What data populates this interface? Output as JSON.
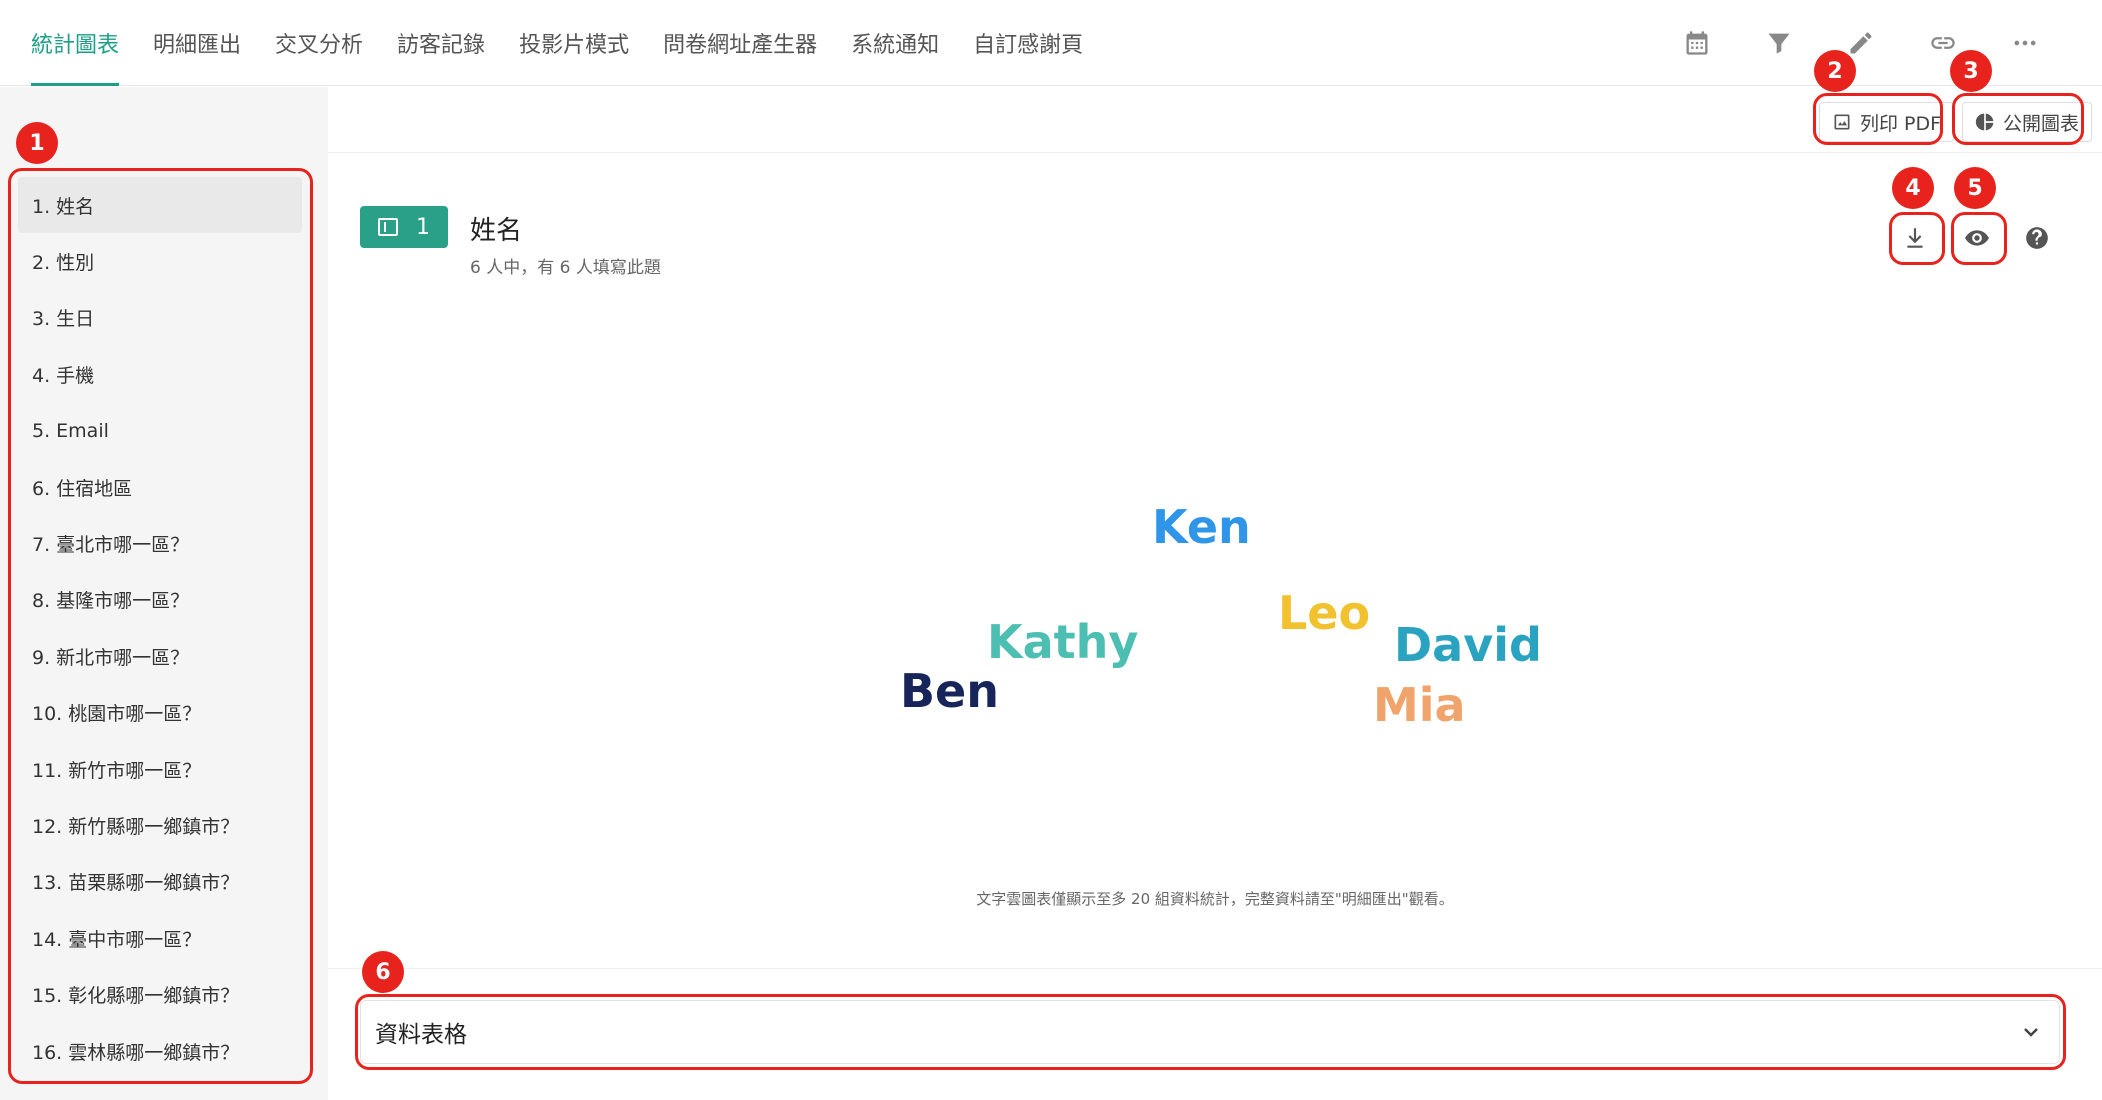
{
  "tabs": [
    "統計圖表",
    "明細匯出",
    "交叉分析",
    "訪客記錄",
    "投影片模式",
    "問卷網址產生器",
    "系統通知",
    "自訂感謝頁"
  ],
  "toolbar_icons": [
    "calendar-icon",
    "filter-icon",
    "edit-icon",
    "link-icon",
    "more-icon"
  ],
  "actions": {
    "print_pdf": "列印 PDF",
    "public_chart": "公開圖表"
  },
  "sidebar": {
    "items": [
      {
        "label": "1.  姓名"
      },
      {
        "label": "2.  性別"
      },
      {
        "label": "3.  生日"
      },
      {
        "label": "4.  手機"
      },
      {
        "label": "5.  Email"
      },
      {
        "label": "6.  住宿地區"
      },
      {
        "label": "7.  臺北市哪一區？"
      },
      {
        "label": "8.  基隆市哪一區？"
      },
      {
        "label": "9.  新北市哪一區？"
      },
      {
        "label": "10.  桃園市哪一區？"
      },
      {
        "label": "11.  新竹市哪一區？"
      },
      {
        "label": "12.  新竹縣哪一鄉鎮市？"
      },
      {
        "label": "13.  苗栗縣哪一鄉鎮市？"
      },
      {
        "label": "14.  臺中市哪一區？"
      },
      {
        "label": "15.  彰化縣哪一鄉鎮市？"
      },
      {
        "label": "16.  雲林縣哪一鄉鎮市？"
      }
    ]
  },
  "question": {
    "number": "1",
    "title": "姓名",
    "subtitle": "6 人中，有 6 人填寫此題"
  },
  "chart_data": {
    "type": "wordcloud",
    "words": [
      {
        "text": "Ken",
        "color": "#2f95e8"
      },
      {
        "text": "Leo",
        "color": "#f2c12e"
      },
      {
        "text": "Kathy",
        "color": "#4cbfb2"
      },
      {
        "text": "David",
        "color": "#2aa3c0"
      },
      {
        "text": "Ben",
        "color": "#17255a"
      },
      {
        "text": "Mia",
        "color": "#f0a36b"
      }
    ]
  },
  "note": "文字雲圖表僅顯示至多 20 組資料統計，完整資料請至\"明細匯出\"觀看。",
  "data_table_label": "資料表格",
  "markers": [
    "1",
    "2",
    "3",
    "4",
    "5",
    "6"
  ],
  "colors": {
    "accent": "#1d9e87",
    "annotation": "#e8231d"
  }
}
